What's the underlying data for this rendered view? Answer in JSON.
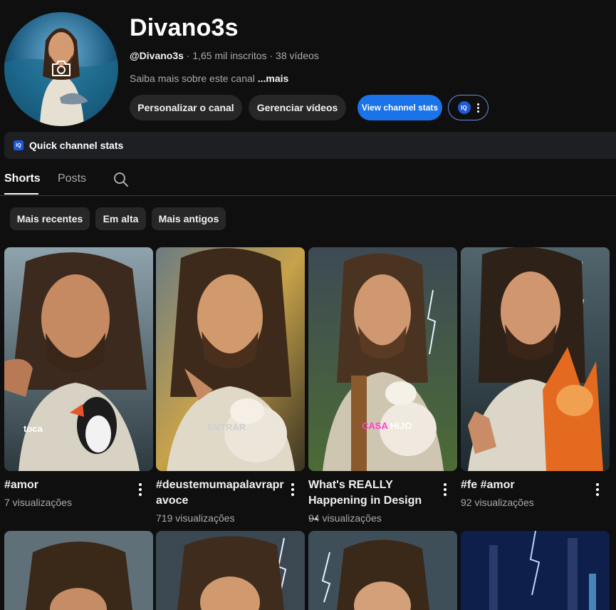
{
  "channel": {
    "name": "Divano3s",
    "handle": "@Divano3s",
    "subscribers": "· 1,65 mil inscritos",
    "videos": "· 38 vídeos",
    "about": "Saiba mais sobre este canal",
    "about_more": "...mais"
  },
  "actions": {
    "customize": "Personalizar o canal",
    "manage": "Gerenciar vídeos",
    "stats": "View channel stats",
    "ext_icon": "IQ"
  },
  "quick_stats": {
    "icon": "IQ",
    "label": "Quick channel stats"
  },
  "tabs": {
    "shorts": "Shorts",
    "posts": "Posts"
  },
  "chips": [
    "Mais recentes",
    "Em alta",
    "Mais antigos"
  ],
  "shorts": [
    {
      "title": "#amor",
      "views": "7 visualizações",
      "caption": "toca"
    },
    {
      "title": "#deustemumapalavraprvoce",
      "title_line1": "#deustemumapalavrapr",
      "title_line2": "avoce",
      "views": "719 visualizações",
      "caption": "ENTRAR"
    },
    {
      "title_line1": "What's REALLY",
      "title_line2": "Happening in Design ...",
      "views": "94 visualizações",
      "caption_a": "CASA",
      "caption_b": "HIJO"
    },
    {
      "title": "#fe #amor",
      "views": "92 visualizações"
    }
  ],
  "colors": {
    "accent": "#1a73e8",
    "background": "#0f0f0f",
    "chip": "#272727",
    "caption_pink": "#ff3fd0"
  }
}
